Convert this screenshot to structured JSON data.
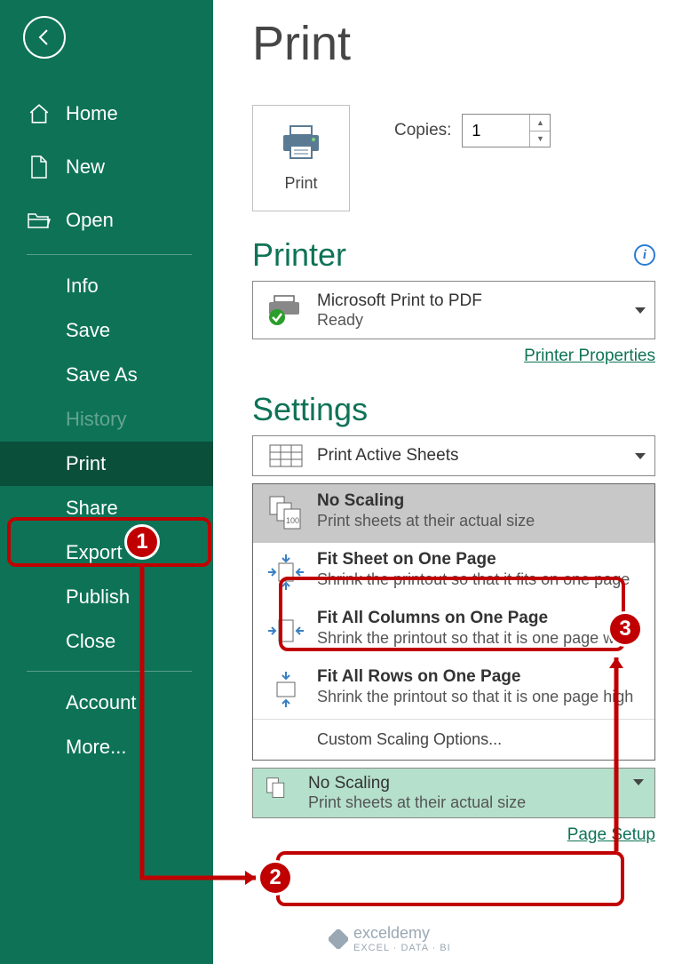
{
  "sidebar": {
    "top": [
      {
        "label": "Home"
      },
      {
        "label": "New"
      },
      {
        "label": "Open"
      }
    ],
    "sub": [
      {
        "label": "Info"
      },
      {
        "label": "Save"
      },
      {
        "label": "Save As"
      },
      {
        "label": "History",
        "disabled": true
      },
      {
        "label": "Print",
        "selected": true
      },
      {
        "label": "Share"
      },
      {
        "label": "Export"
      },
      {
        "label": "Publish"
      },
      {
        "label": "Close"
      }
    ],
    "bottom": [
      {
        "label": "Account"
      },
      {
        "label": "More..."
      }
    ]
  },
  "main": {
    "title": "Print",
    "print_button": "Print",
    "copies_label": "Copies:",
    "copies_value": "1",
    "printer_header": "Printer",
    "printer": {
      "name": "Microsoft Print to PDF",
      "status": "Ready"
    },
    "printer_properties": "Printer Properties",
    "settings_header": "Settings",
    "active_sheets": "Print Active Sheets",
    "scaling_options": [
      {
        "title": "No Scaling",
        "desc": "Print sheets at their actual size"
      },
      {
        "title": "Fit Sheet on One Page",
        "desc": "Shrink the printout so that it fits on one page"
      },
      {
        "title": "Fit All Columns on One Page",
        "desc": "Shrink the printout so that it is one page wide"
      },
      {
        "title": "Fit All Rows on One Page",
        "desc": "Shrink the printout so that it is one page high"
      }
    ],
    "custom_scaling": "Custom Scaling Options...",
    "current_scaling": {
      "title": "No Scaling",
      "desc": "Print sheets at their actual size"
    },
    "page_setup": "Page Setup"
  },
  "callouts": {
    "c1": "1",
    "c2": "2",
    "c3": "3"
  },
  "watermark": {
    "brand": "exceldemy",
    "tag": "EXCEL · DATA · BI"
  }
}
